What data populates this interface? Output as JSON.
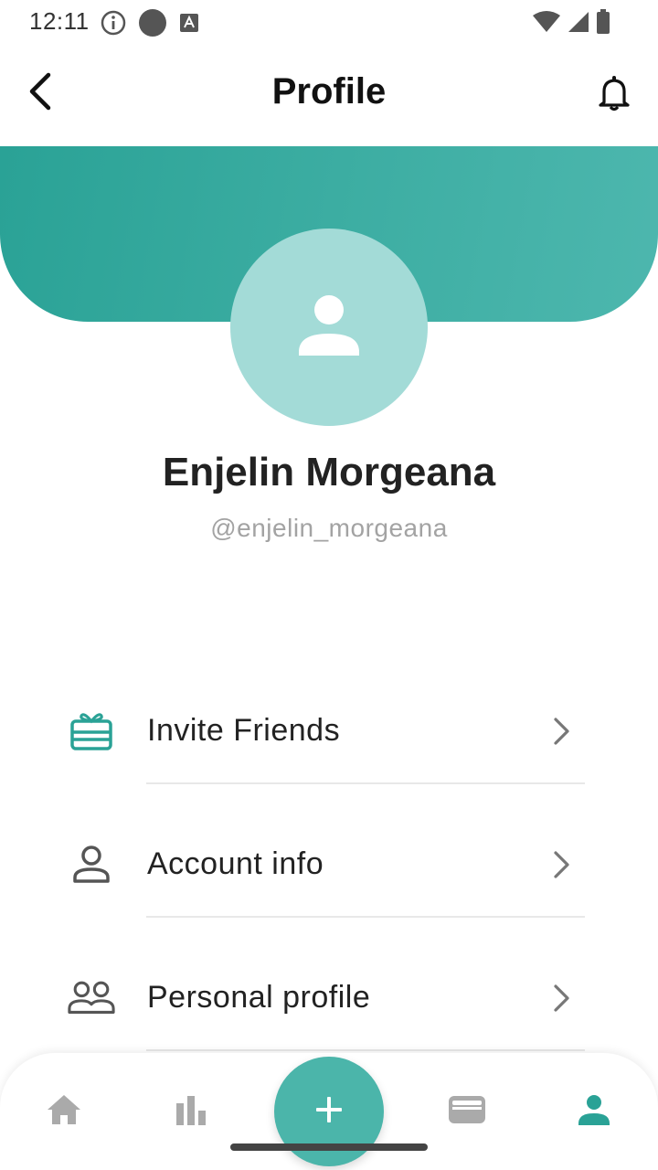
{
  "status_bar": {
    "time": "12:11",
    "icons": [
      "info-icon",
      "circle-icon",
      "a-icon",
      "wifi-icon",
      "signal-icon",
      "battery-icon"
    ]
  },
  "app_bar": {
    "title": "Profile",
    "back_icon": "chevron-left-icon",
    "action_icon": "bell-icon"
  },
  "profile": {
    "name": "Enjelin Morgeana",
    "handle": "@enjelin_morgeana",
    "avatar_icon": "user-icon"
  },
  "menu": {
    "items": [
      {
        "label": "Invite Friends",
        "icon": "gift-card-icon",
        "icon_color": "#2aa296"
      },
      {
        "label": "Account info",
        "icon": "person-outline-icon",
        "icon_color": "#555555"
      },
      {
        "label": "Personal profile",
        "icon": "people-outline-icon",
        "icon_color": "#555555"
      }
    ]
  },
  "bottom_nav": {
    "items": [
      "home-icon",
      "bar-chart-icon",
      "add-icon",
      "wallet-icon",
      "user-icon"
    ],
    "active": "user-icon"
  },
  "colors": {
    "accent": "#2aa296",
    "accent_light": "#a3dbd7",
    "fab": "#4bb5aa",
    "inactive_icon": "#aaaaaa"
  }
}
